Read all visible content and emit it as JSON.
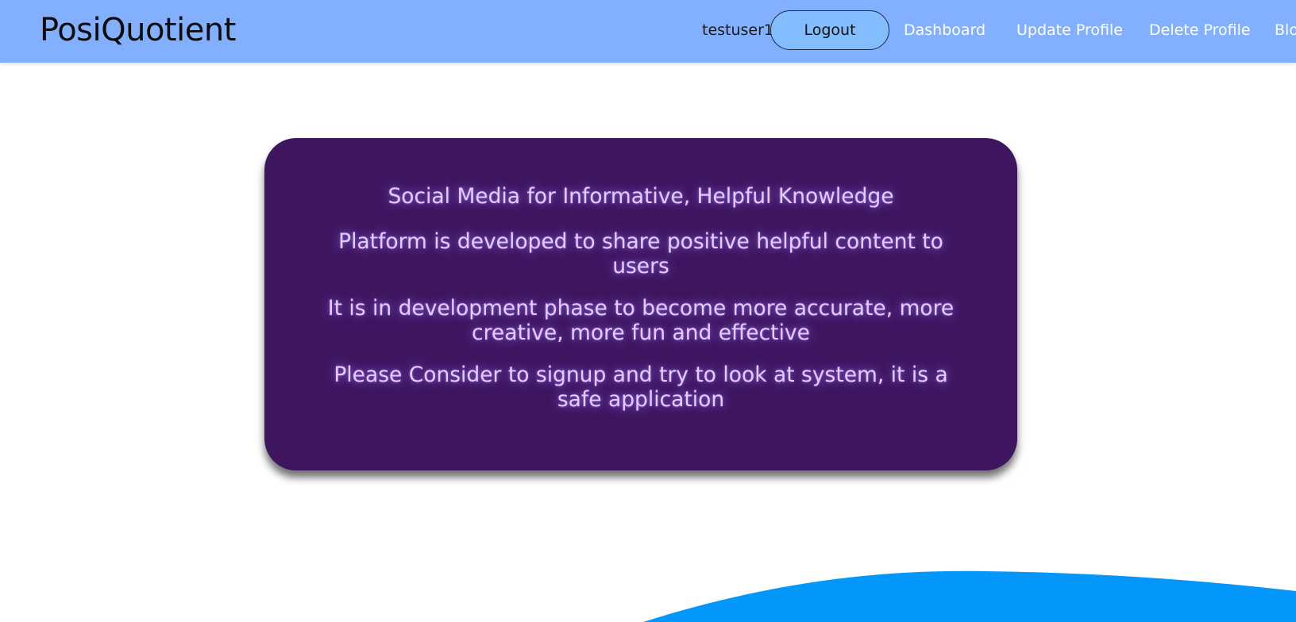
{
  "brand": "PosiQuotient",
  "header": {
    "username": "testuser1",
    "logout_label": "Logout",
    "nav": {
      "dashboard": "Dashboard",
      "update_profile": "Update Profile",
      "delete_profile": "Delete Profile",
      "blog_partial": "Blo"
    }
  },
  "card": {
    "lines": [
      "Social Media for Informative, Helpful Knowledge",
      "Platform is developed to share positive helpful content to users",
      "It is in development phase to become more accurate, more creative, more fun and effective",
      "Please Consider to signup and try to look at system, it is a safe application"
    ]
  },
  "colors": {
    "navbar": "#82b0ff",
    "logout_button": "#83bdfd",
    "card_background": "#3e1660",
    "card_text": "#e2cdff",
    "wave": "#0397fb"
  }
}
